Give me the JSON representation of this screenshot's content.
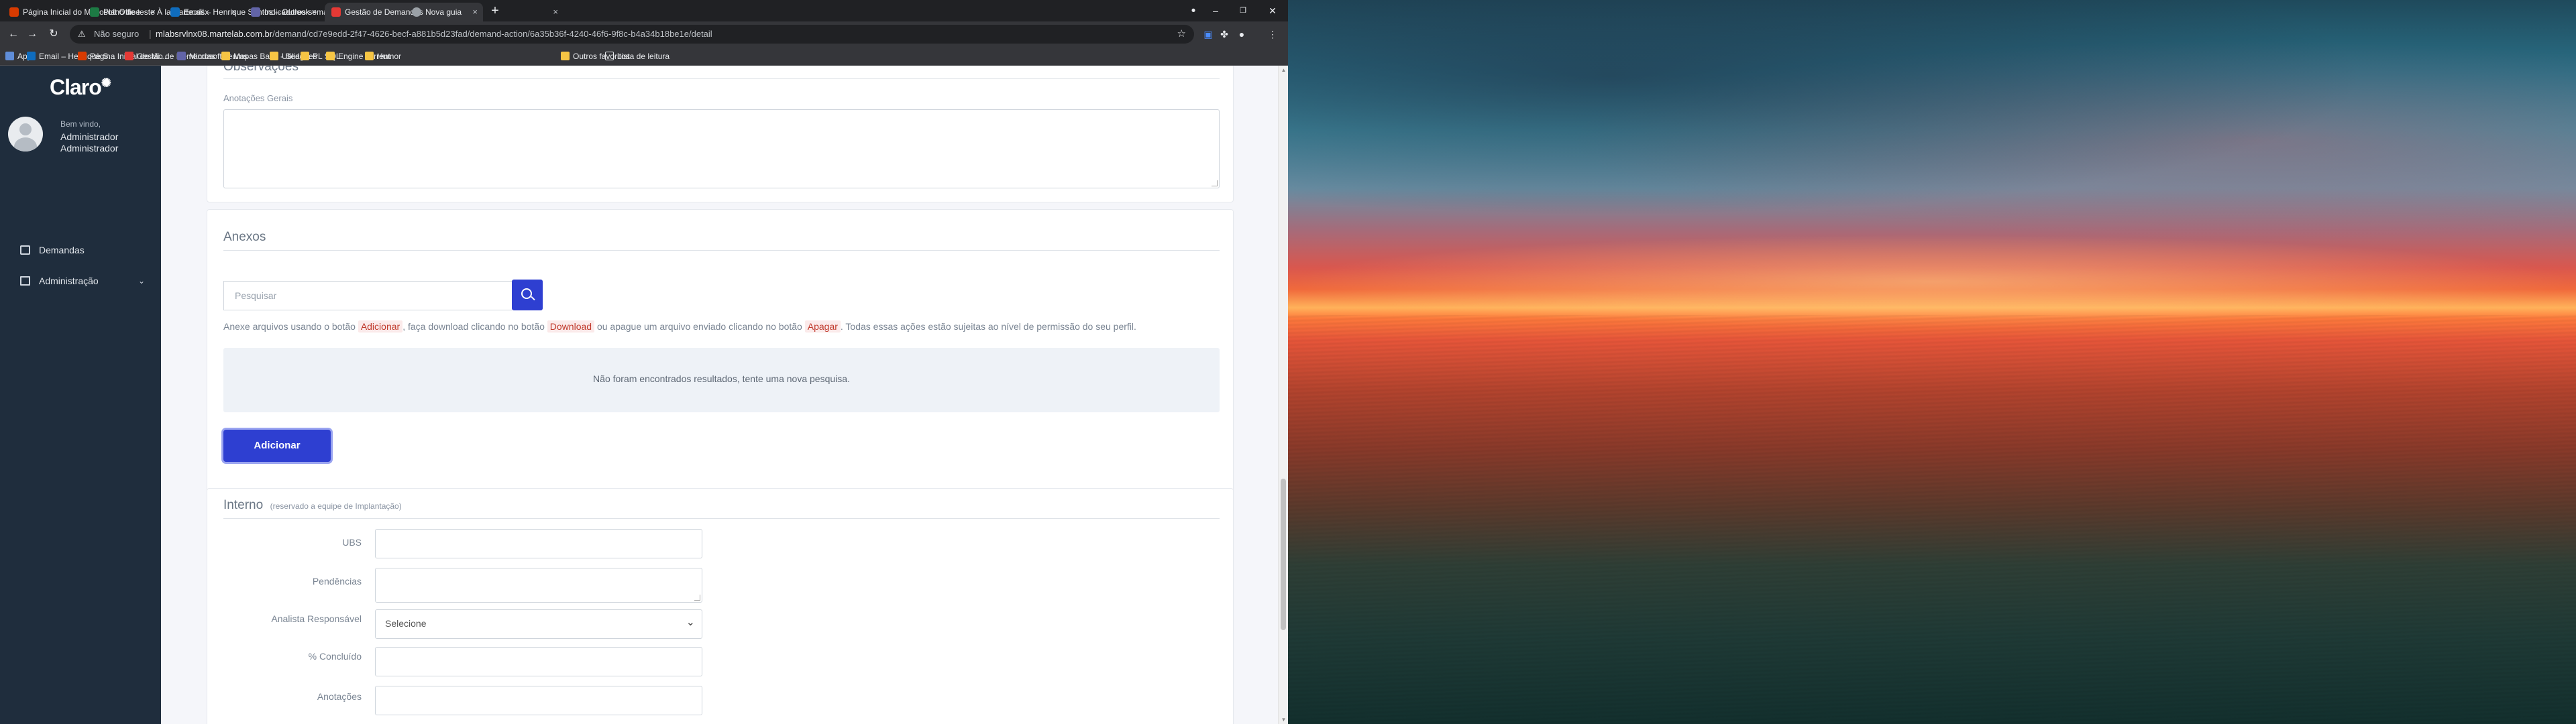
{
  "tabs": [
    {
      "title": "Página Inicial do Microsoft Office",
      "favicon_color": "#d83b01"
    },
    {
      "title": "Plano de teste À la Carte.xlsx",
      "favicon_color": "#1d7a44"
    },
    {
      "title": "Email – Henrique Santos – Outlook",
      "favicon_color": "#0f6cbd"
    },
    {
      "title": "Indicadores semanais | Microsoft",
      "favicon_color": "#6264a7"
    },
    {
      "title": "Gestão de Demandas",
      "favicon_color": "#e53935"
    },
    {
      "title": "Nova guia",
      "favicon_color": "#9aa0a6"
    }
  ],
  "tab_close_glyph": "×",
  "new_tab_glyph": "+",
  "window": {
    "minimize": "–",
    "maximize": "❐",
    "close": "✕"
  },
  "address": {
    "security": "Não seguro",
    "host": "mlabsrvlnx08.martelab.com.br",
    "path": "/demand/cd7e9edd-2f47-4626-becf-a881b5d23fad/demand-action/6a35b36f-4240-46f6-9f8c-b4a34b18be1e/detail"
  },
  "bookmarks": {
    "apps": "Apps",
    "items": [
      {
        "label": "Email – Henrique S...",
        "icon_color": "#0f6cbd"
      },
      {
        "label": "Página Inicial do Mi...",
        "icon_color": "#d83b01"
      },
      {
        "label": "Gestão de Demandas",
        "icon_color": "#e53935"
      },
      {
        "label": "Microsoft Teams",
        "icon_color": "#6264a7"
      },
      {
        "label": "Mapas Base - Seag...",
        "icon_color": "#f6c544"
      },
      {
        "label": "Utilidades",
        "icon_color": "#f6c544"
      },
      {
        "label": "PL SQL",
        "icon_color": "#f6c544"
      },
      {
        "label": "Engine Torrent",
        "icon_color": "#f6c544"
      },
      {
        "label": "Humor",
        "icon_color": "#f6c544"
      }
    ],
    "other": "Outros favoritos",
    "reading_list": "Lista de leitura"
  },
  "sidebar": {
    "logo": "Claro",
    "welcome": "Bem vindo,",
    "user_line1": "Administrador",
    "user_line2": "Administrador",
    "nav": [
      {
        "label": "Demandas"
      },
      {
        "label": "Administração"
      }
    ]
  },
  "observacoes": {
    "title": "Observações",
    "general_notes_label": "Anotações Gerais",
    "general_notes_value": ""
  },
  "anexos": {
    "title": "Anexos",
    "search_placeholder": "Pesquisar",
    "help_part1": "Anexe arquivos usando o botão ",
    "help_code1": "Adicionar",
    "help_part2": ", faça download clicando no botão ",
    "help_code2": "Download",
    "help_part3": " ou apague um arquivo enviado clicando no botão ",
    "help_code3": "Apagar",
    "help_part4": ". Todas essas ações estão sujeitas ao nível de permissão do seu perfil.",
    "empty_message": "Não foram encontrados resultados, tente uma nova pesquisa.",
    "add_button": "Adicionar"
  },
  "interno": {
    "title": "Interno",
    "subtitle": "(reservado a equipe de Implantação)",
    "fields": {
      "ubs": {
        "label": "UBS",
        "value": ""
      },
      "pendencias": {
        "label": "Pendências",
        "value": ""
      },
      "analista": {
        "label": "Analista Responsável",
        "value": "Selecione"
      },
      "concluido": {
        "label": "% Concluído",
        "value": ""
      },
      "anotacoes": {
        "label": "Anotações",
        "value": ""
      }
    }
  }
}
